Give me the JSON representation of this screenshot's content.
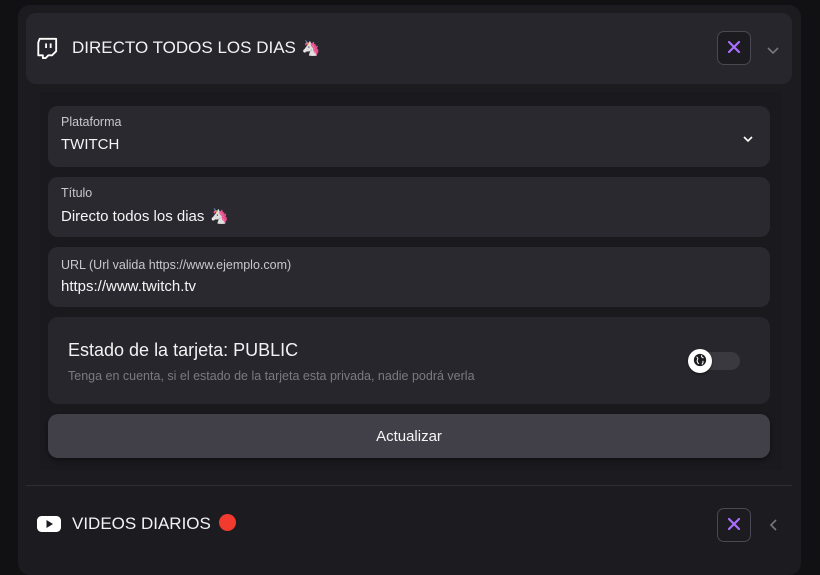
{
  "cards": [
    {
      "title": "DIRECTO TODOS LOS DIAS",
      "title_emoji": "🦄",
      "icon": "twitch-icon",
      "expanded": true
    },
    {
      "title": "VIDEOS DIARIOS",
      "icon": "youtube-icon",
      "expanded": false
    }
  ],
  "form": {
    "platform": {
      "label": "Plataforma",
      "value": "TWITCH"
    },
    "title_field": {
      "label": "Título",
      "value": "Directo todos los dias",
      "emoji": "🦄"
    },
    "url_field": {
      "label": "URL (Url valida https://www.ejemplo.com)",
      "value": "https://www.twitch.tv"
    },
    "state": {
      "title": "Estado de la tarjeta: PUBLIC",
      "help": "Tenga en cuenta, si el estado de la tarjeta esta privada, nadie podrá verla",
      "toggle_icon": "globe-icon",
      "is_private": false
    },
    "update_label": "Actualizar"
  },
  "colors": {
    "accent": "#a970ff",
    "youtube_red": "#f23b2e"
  }
}
